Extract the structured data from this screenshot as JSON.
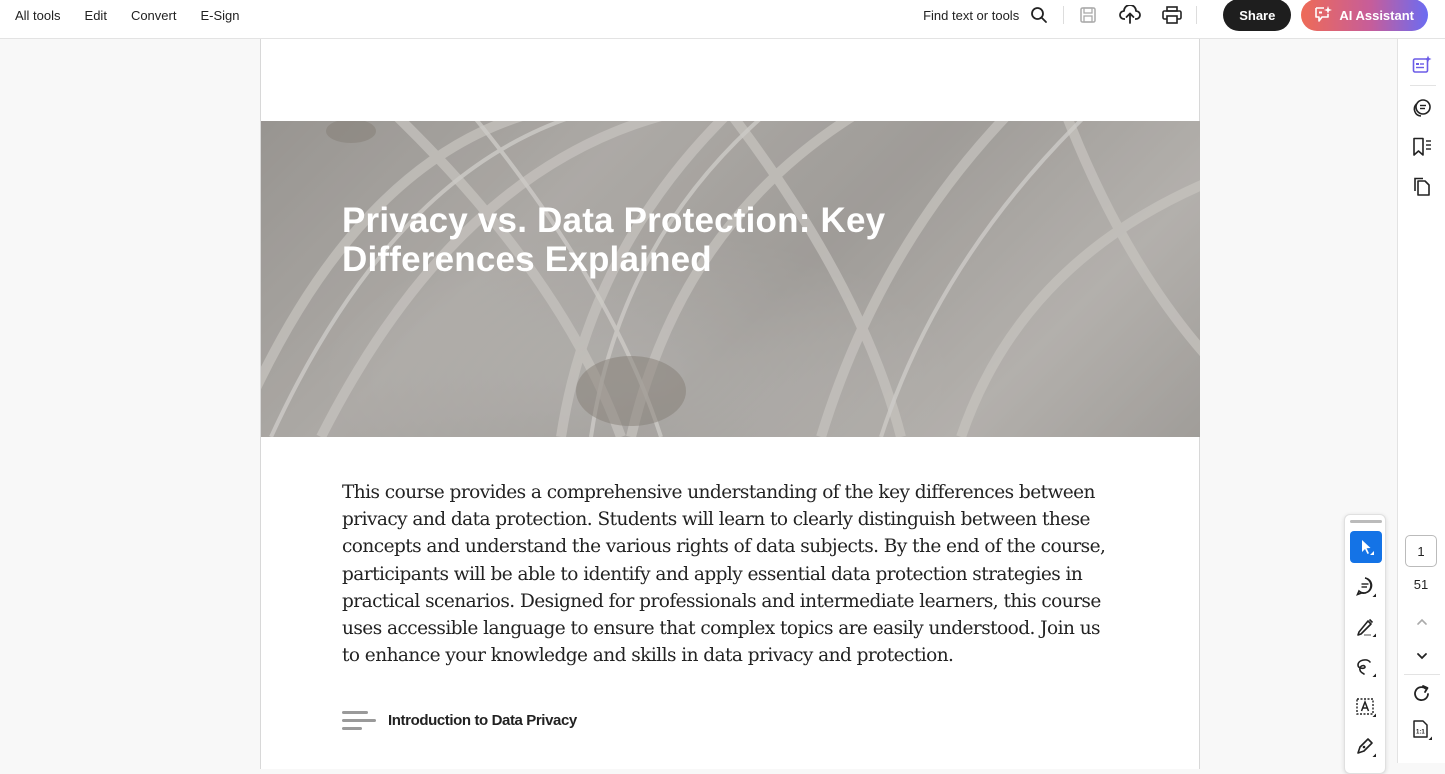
{
  "topbar": {
    "menu": [
      "All tools",
      "Edit",
      "Convert",
      "E-Sign"
    ],
    "find_label": "Find text or tools",
    "share_label": "Share",
    "ai_label": "AI Assistant",
    "icons": [
      "search-icon",
      "save-icon",
      "upload-cloud-icon",
      "print-icon",
      "ai-assistant-icon"
    ]
  },
  "document": {
    "title": "Privacy vs. Data Protection: Key Differences Explained",
    "body": "This course provides a comprehensive understanding of the key differences between privacy and data protection. Students will learn to clearly distinguish between these concepts and understand the various rights of data subjects. By the end of the course, participants will be able to identify and apply essential data protection strategies in practical scenarios. Designed for professionals and intermediate learners, this course uses accessible language to ensure that complex topics are easily understood. Join us to enhance your knowledge and skills in data privacy and protection.",
    "section_title": "Introduction to Data Privacy"
  },
  "right_panel": {
    "icons": [
      "ai-generative-summary-icon",
      "comments-icon",
      "bookmarks-icon",
      "pages-icon"
    ]
  },
  "floating_tools": [
    "select-icon",
    "add-comment-icon",
    "highlight-icon",
    "draw-freeform-icon",
    "text-recognition-icon",
    "sign-icon"
  ],
  "page_nav": {
    "current_page": "1",
    "total_pages": "51",
    "icons": [
      "chevron-up-icon",
      "chevron-down-icon",
      "rotate-icon",
      "actual-size-icon"
    ]
  },
  "colors": {
    "accent": "#1473e6",
    "share_bg": "#1e1e1e",
    "ai_gradient_start": "#ee6b57",
    "ai_gradient_end": "#6b6cf2",
    "ai_icon": "#6b5ce7"
  }
}
